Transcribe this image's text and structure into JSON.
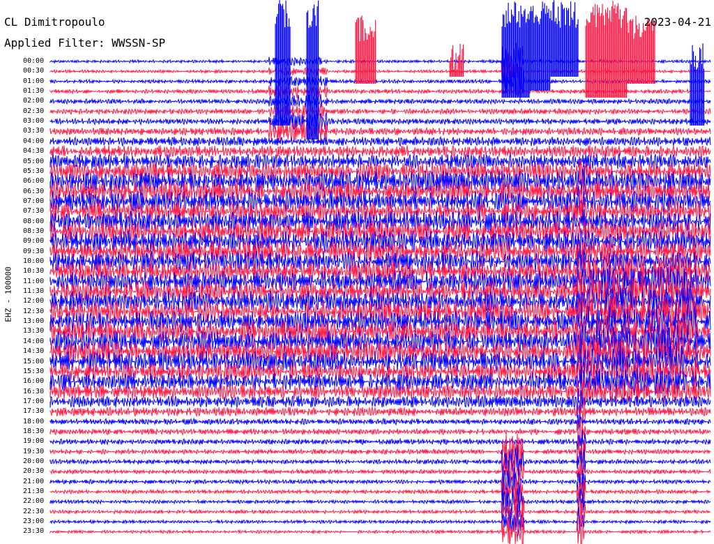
{
  "header": {
    "station": "CL Dimitropoulo",
    "filter": "Applied Filter: WWSSN-SP",
    "date": "2023-04-21"
  },
  "chart_data": {
    "type": "line",
    "title": "CL Dimitropoulo",
    "subtitle": "Applied Filter: WWSSN-SP",
    "date": "2023-04-21",
    "ylabel": "EHZ - 100000",
    "trace_interval_minutes": 30,
    "y_ticks": [
      "00:00",
      "00:30",
      "01:00",
      "01:30",
      "02:00",
      "02:30",
      "03:00",
      "03:30",
      "04:00",
      "04:30",
      "05:00",
      "05:30",
      "06:00",
      "06:30",
      "07:00",
      "07:30",
      "08:00",
      "08:30",
      "09:00",
      "09:30",
      "10:00",
      "10:30",
      "11:00",
      "11:30",
      "12:00",
      "12:30",
      "13:00",
      "13:30",
      "14:00",
      "14:30",
      "15:00",
      "15:30",
      "16:00",
      "16:30",
      "17:00",
      "17:30",
      "18:00",
      "18:30",
      "19:00",
      "19:30",
      "20:00",
      "20:30",
      "21:00",
      "21:30",
      "22:00",
      "22:30",
      "23:00",
      "23:30"
    ],
    "series_colors": [
      "#0000ff",
      "#ff1744"
    ],
    "relative_amplitude_by_trace": [
      1,
      1,
      1.2,
      1.4,
      1.6,
      1.8,
      2,
      2.5,
      3,
      4,
      5,
      6,
      7,
      7,
      7,
      7,
      7,
      7,
      7,
      7,
      7,
      7,
      7,
      7,
      7,
      7,
      7,
      7,
      7,
      7,
      7,
      6,
      6,
      5,
      4,
      3,
      2,
      2,
      1.8,
      1.6,
      1.5,
      1.4,
      1.4,
      1.3,
      1.2,
      1.2,
      1.1,
      1
    ],
    "grid": false,
    "legend": "none"
  }
}
